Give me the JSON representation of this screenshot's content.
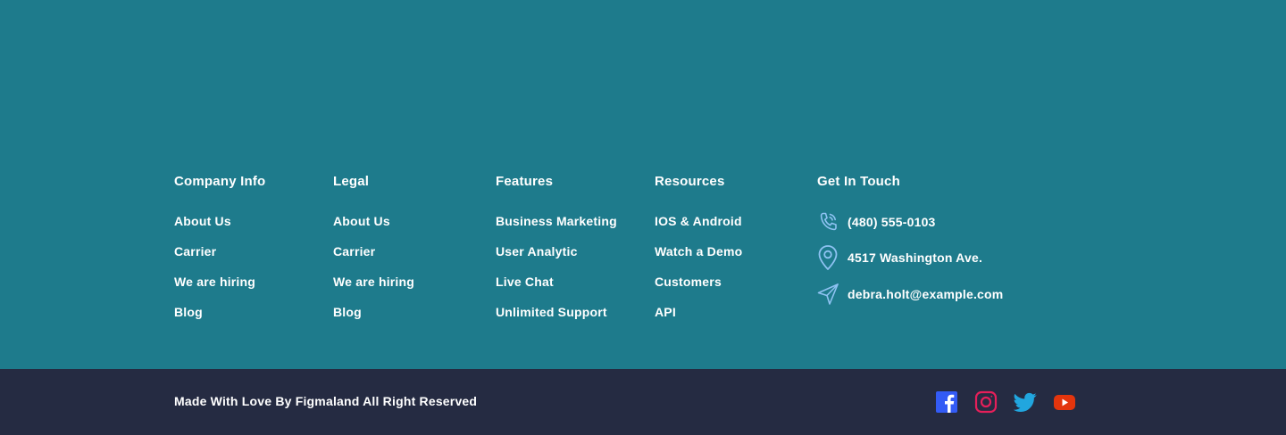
{
  "columns": [
    {
      "title": "Company Info",
      "links": [
        "About Us",
        "Carrier",
        "We are hiring",
        "Blog"
      ]
    },
    {
      "title": "Legal",
      "links": [
        "About Us",
        "Carrier",
        "We are hiring",
        "Blog"
      ]
    },
    {
      "title": "Features",
      "links": [
        "Business Marketing",
        "User Analytic",
        "Live Chat",
        "Unlimited Support"
      ]
    },
    {
      "title": "Resources",
      "links": [
        "IOS & Android",
        "Watch a Demo",
        "Customers",
        "API"
      ]
    }
  ],
  "contact": {
    "title": "Get In Touch",
    "phone": "(480) 555-0103",
    "address": "4517 Washington Ave.",
    "email": "debra.holt@example.com"
  },
  "bottom": {
    "copyright": "Made With Love By Figmaland All Right Reserved"
  },
  "social_icons": [
    "facebook-icon",
    "instagram-icon",
    "twitter-icon",
    "youtube-icon"
  ],
  "colors": {
    "top_background": "#1e7b8c",
    "bottom_background": "#252b42",
    "text": "#ffffff",
    "contact_icon": "#8ec2f2",
    "facebook": "#335bf5",
    "instagram": "#e51f5a",
    "twitter": "#21a6df",
    "youtube": "#e3350d"
  }
}
